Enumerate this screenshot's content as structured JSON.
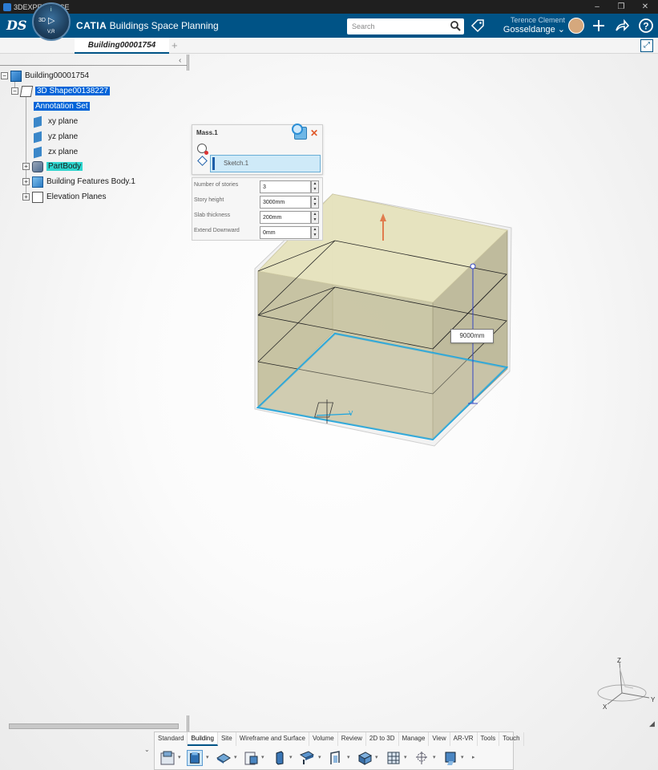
{
  "os": {
    "title": "3DEXPERIENCE",
    "controls": [
      "–",
      "❐",
      "✕"
    ]
  },
  "header": {
    "compass_top": "i",
    "compass_3d": "3D",
    "compass_vr": "V,R",
    "app_brand": "CATIA",
    "app_name": "Buildings Space Planning",
    "search_placeholder": "Search",
    "user_first": "Terence Clement",
    "user_last": "Gosseldange",
    "user_chevron": "⌄"
  },
  "tabs": {
    "active": "Building00001754",
    "add": "+"
  },
  "tree": {
    "collapse": "‹",
    "items": [
      {
        "label": "Building00001754"
      },
      {
        "label": "3D Shape00138227"
      },
      {
        "label": "Annotation Set"
      },
      {
        "label": "xy plane"
      },
      {
        "label": "yz plane"
      },
      {
        "label": "zx plane"
      },
      {
        "label": "PartBody"
      },
      {
        "label": "Building Features Body.1"
      },
      {
        "label": "Elevation Planes"
      }
    ]
  },
  "mass_panel": {
    "title": "Mass.1",
    "sketch": "Sketch.1",
    "params": [
      {
        "label": "Number of stories",
        "value": "3"
      },
      {
        "label": "Story height",
        "value": "3000mm"
      },
      {
        "label": "Slab thickness",
        "value": "200mm"
      },
      {
        "label": "Extend Downward",
        "value": "0mm"
      }
    ]
  },
  "viewport": {
    "dimension": "9000mm",
    "axes": {
      "z": "Z",
      "x": "X",
      "y": "Y"
    },
    "sketch_axis": "V"
  },
  "action_bar": {
    "tabs": [
      "Standard",
      "Building",
      "Site",
      "Wireframe and Surface",
      "Volume",
      "Review",
      "2D to 3D",
      "Manage",
      "View",
      "AR-VR",
      "Tools",
      "Touch"
    ],
    "active_tab": "Building",
    "icons": [
      "floor-plan-icon",
      "mass-icon",
      "slab-icon",
      "space-icon",
      "column-icon",
      "beam-icon",
      "opening-icon",
      "wall-icon",
      "grid-icon",
      "anchor-icon",
      "facade-icon",
      "more-icon"
    ]
  },
  "colors": {
    "header": "#005386",
    "mass_fill": "#c8c39a",
    "mass_top": "#e6e3be",
    "selection_cyan": "#2ed6cf",
    "selection_blue": "#0063d8",
    "sketch_outline": "#1aa4e0"
  }
}
